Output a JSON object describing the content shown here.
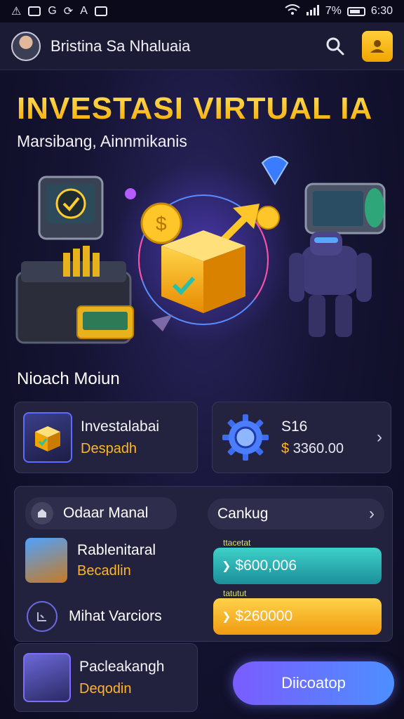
{
  "status_bar": {
    "battery": "7%",
    "time": "6:30"
  },
  "header": {
    "user_name": "Bristina Sa Nhaluaia"
  },
  "hero": {
    "title": "INVESTASI VIRTUAL IA",
    "subtitle": "Marsibang, Ainnmikanis"
  },
  "section": {
    "title": "Nioach Moiun"
  },
  "invest_card": {
    "label": "Investalabai",
    "sub": "Despadh"
  },
  "balance_card": {
    "label": "S16",
    "currency": "$",
    "amount": "3360.00"
  },
  "panel": {
    "order_label": "Odaar Manal",
    "category_label": "Cankug",
    "recommend": {
      "title": "Rablenitaral",
      "sub": "Becadlin"
    },
    "view_label": "Mihat Varciors",
    "bar1": {
      "tag": "ttacetat",
      "value": "$600,006"
    },
    "bar2": {
      "tag": "tatutut",
      "value": "$260000"
    }
  },
  "deposit_card": {
    "title": "Pacleakangh",
    "sub": "Deqodin"
  },
  "cta_label": "Diicoatop",
  "colors": {
    "accent_gold": "#ffb52a",
    "accent_teal": "#2fbfbe",
    "button_blue": "#5b7dff"
  }
}
